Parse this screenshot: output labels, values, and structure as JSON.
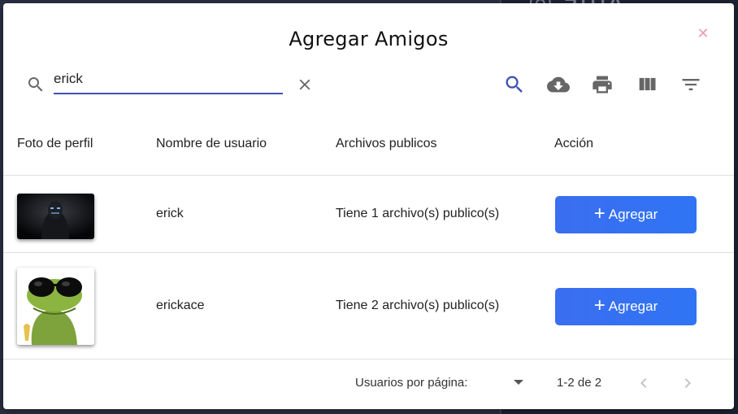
{
  "dialog": {
    "title": "Agregar Amigos",
    "close_icon": "close-icon"
  },
  "toolbar": {
    "search_value": "erick",
    "icons": [
      "search-icon",
      "clear-icon",
      "search-icon",
      "download-icon",
      "print-icon",
      "view-columns-icon",
      "filter-icon"
    ],
    "accent_color": "#3f51b5"
  },
  "table": {
    "headers": [
      "Foto de perfil",
      "Nombre de usuario",
      "Archivos publicos",
      "Acción"
    ],
    "rows": [
      {
        "username": "erick",
        "files": "Tiene 1 archivo(s) publico(s)",
        "action_label": "Agregar"
      },
      {
        "username": "erickace",
        "files": "Tiene 2 archivo(s) publico(s)",
        "action_label": "Agregar"
      }
    ],
    "button_color": "#3470f2"
  },
  "footer": {
    "rows_per_page_label": "Usuarios por página:",
    "range_label": "1-2 de 2"
  }
}
